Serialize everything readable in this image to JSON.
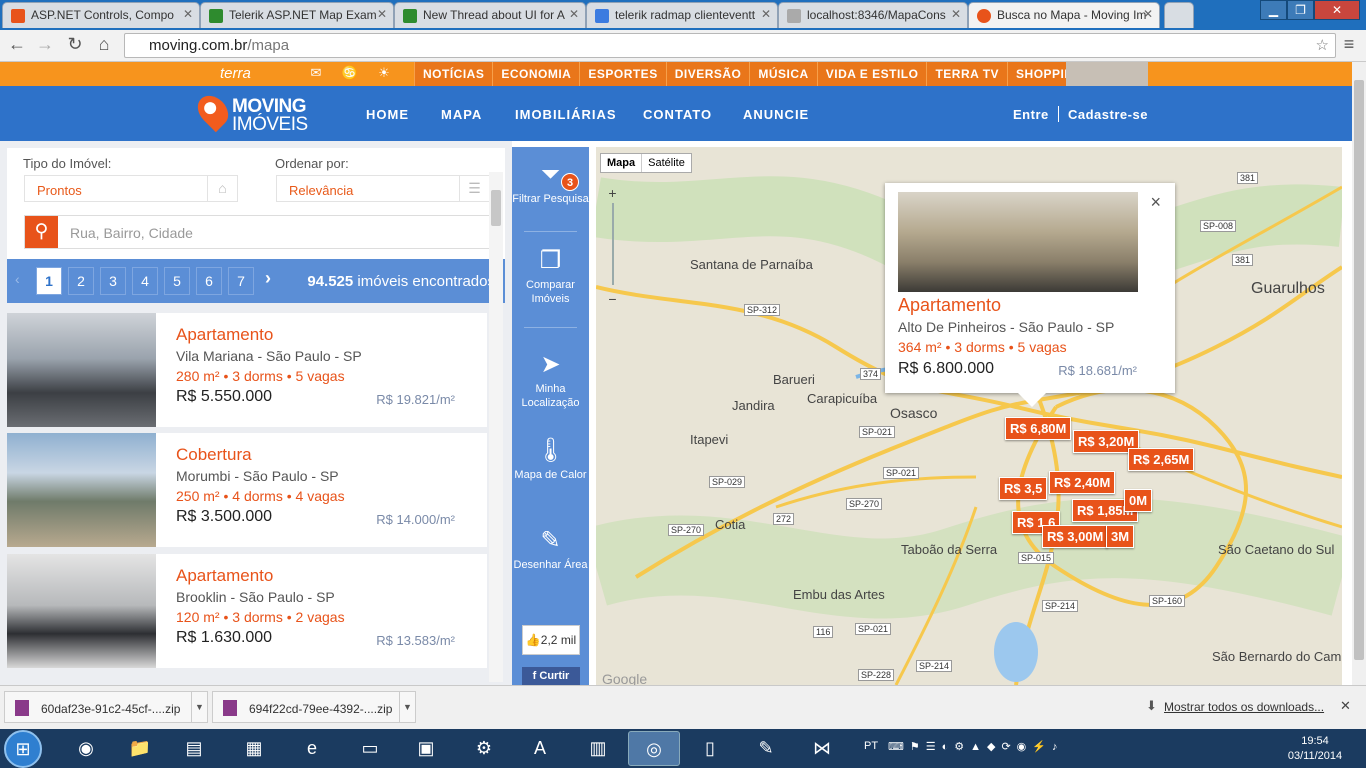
{
  "browser": {
    "tabs": [
      {
        "title": "ASP.NET Controls, Compo",
        "color": "#e8531a"
      },
      {
        "title": "Telerik ASP.NET Map Exam",
        "color": "#2e8b2e"
      },
      {
        "title": "New Thread about UI for A",
        "color": "#2e8b2e"
      },
      {
        "title": "telerik radmap clienteventt",
        "color": "#3b7be0"
      },
      {
        "title": "localhost:8346/MapaCons",
        "color": "#aaaaaa"
      },
      {
        "title": "Busca no Mapa - Moving Im",
        "color": "#e8531a"
      }
    ],
    "url_host": "moving.com.br",
    "url_path": "/mapa"
  },
  "terra": {
    "logo": "terra",
    "nav": [
      "NOTÍCIAS",
      "ECONOMIA",
      "ESPORTES",
      "DIVERSÃO",
      "MÚSICA",
      "VIDA E ESTILO",
      "TERRA TV",
      "SHOPPING"
    ]
  },
  "site": {
    "brand_top": "MOVING",
    "brand_bottom": "IMÓVEIS",
    "nav": [
      "HOME",
      "MAPA",
      "IMOBILIÁRIAS",
      "CONTATO",
      "ANUNCIE"
    ],
    "login": "Entre",
    "signup": "Cadastre-se"
  },
  "filters": {
    "type_label": "Tipo do Imóvel:",
    "type_value": "Prontos",
    "order_label": "Ordenar por:",
    "order_value": "Relevância",
    "search_placeholder": "Rua, Bairro, Cidade"
  },
  "pagination": {
    "pages": [
      "1",
      "2",
      "3",
      "4",
      "5",
      "6",
      "7"
    ],
    "current": "1",
    "count": "94.525",
    "count_suffix": "imóveis encontrados"
  },
  "listings": [
    {
      "type": "Apartamento",
      "location": "Vila Mariana - São Paulo - SP",
      "area": "280 m²",
      "dorms": "3 dorms",
      "vagas": "5 vagas",
      "price": "R$ 5.550.000",
      "per_m2": "R$ 19.821/m²"
    },
    {
      "type": "Cobertura",
      "location": "Morumbi - São Paulo - SP",
      "area": "250 m²",
      "dorms": "4 dorms",
      "vagas": "4 vagas",
      "price": "R$ 3.500.000",
      "per_m2": "R$ 14.000/m²"
    },
    {
      "type": "Apartamento",
      "location": "Brooklin - São Paulo - SP",
      "area": "120 m²",
      "dorms": "3 dorms",
      "vagas": "2 vagas",
      "price": "R$ 1.630.000",
      "per_m2": "R$ 13.583/m²"
    }
  ],
  "tools": {
    "filter": "Filtrar Pesquisa",
    "filter_badge": "3",
    "compare": "Comparar Imóveis",
    "location": "Minha Localização",
    "heat": "Mapa de Calor",
    "draw": "Desenhar Área",
    "likes": "2,2 mil",
    "fb_like": "Curtir"
  },
  "map": {
    "type_map": "Mapa",
    "type_satellite": "Satélite",
    "labels": [
      "Santana de Parnaíba",
      "Barueri",
      "Jandira",
      "Carapicuíba",
      "Osasco",
      "Itapevi",
      "Cotia",
      "Taboão da Serra",
      "Embu das Artes",
      "Guarulhos",
      "São Caetano do Sul",
      "São Bernardo do Campo",
      "Google"
    ],
    "roads": [
      "SP-312",
      "374",
      "SP-021",
      "SP-029",
      "SP-270",
      "272",
      "SP-021",
      "SP-270",
      "SP-015",
      "SP-214",
      "SP-160",
      "SP-228",
      "SP-214",
      "116",
      "SP-021",
      "381",
      "SP-008",
      "381"
    ],
    "markers": [
      "R$ 6,80M",
      "R$ 3,20M",
      "R$ 2,65M",
      "R$ 2,40M",
      "R$ 3,5",
      "R$ 1,85M",
      "R$ 1,6",
      "R$ 3,00M",
      "3M",
      "0M"
    ],
    "popup": {
      "type": "Apartamento",
      "location": "Alto De Pinheiros - São Paulo - SP",
      "area": "364 m²",
      "dorms": "3 dorms",
      "vagas": "5 vagas",
      "price": "R$ 6.800.000",
      "per_m2": "R$ 18.681/m²"
    }
  },
  "downloads": {
    "items": [
      "60daf23e-91c2-45cf-....zip",
      "694f22cd-79ee-4392-....zip"
    ],
    "show_all": "Mostrar todos os downloads..."
  },
  "taskbar": {
    "lang": "PT",
    "time": "19:54",
    "date": "03/11/2014"
  }
}
